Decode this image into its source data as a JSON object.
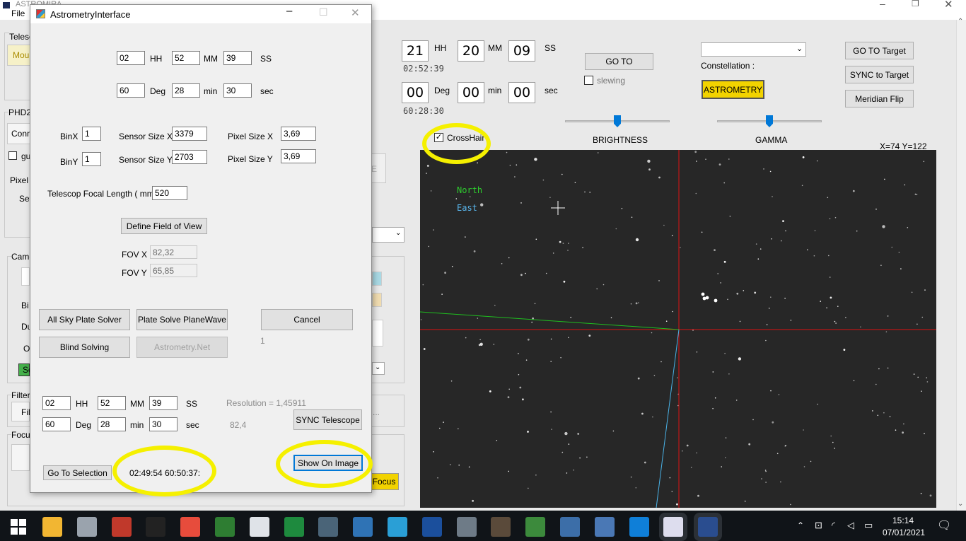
{
  "main": {
    "app_title": "ASTROMIRA",
    "menu_file": "File",
    "bg_fragments": [
      "Telesc",
      "Mour",
      "PHD2",
      "Conn",
      "gu",
      "Pixel",
      "Set",
      "Came",
      "Bi",
      "Du",
      "O",
      "Se",
      "Filter",
      "Fil",
      "Focu",
      "Focus",
      "E"
    ],
    "time": {
      "hh": "21",
      "mm": "20",
      "ss": "09",
      "hh_label": "HH",
      "mm_label": "MM",
      "ss_label": "SS",
      "readout": "02:52:39"
    },
    "dec": {
      "deg": "00",
      "min": "00",
      "sec": "00",
      "deg_label": "Deg",
      "min_label": "min",
      "sec_label": "sec",
      "readout": "60:28:30"
    },
    "goto_label": "GO TO",
    "slewing_label": "slewing",
    "crosshair_label": "CrossHair",
    "constellation_label": "Constellation :",
    "astrometry_label": "ASTROMETRY",
    "goto_target_label": "GO TO Target",
    "sync_target_label": "SYNC to Target",
    "meridian_flip_label": "Meridian Flip",
    "brightness_label": "BRIGHTNESS",
    "gamma_label": "GAMMA",
    "coords_label": "X=74 Y=122",
    "north_label": "North",
    "east_label": "East"
  },
  "dialog": {
    "title": "AstrometryInterface",
    "ra": {
      "hh": "02",
      "mm": "52",
      "ss": "39",
      "hh_label": "HH",
      "mm_label": "MM",
      "ss_label": "SS"
    },
    "dec": {
      "deg": "60",
      "min": "28",
      "sec": "30",
      "deg_label": "Deg",
      "min_label": "min",
      "sec_label": "sec"
    },
    "binx_label": "BinX",
    "binx": "1",
    "biny_label": "BinY",
    "biny": "1",
    "sensor_x_label": "Sensor Size X",
    "sensor_x": "3379",
    "sensor_y_label": "Sensor Size Y",
    "sensor_y": "2703",
    "pixel_x_label": "Pixel Size X",
    "pixel_x": "3,69",
    "pixel_y_label": "Pixel Size Y",
    "pixel_y": "3,69",
    "focal_label": "Telescop Focal Length ( mm )",
    "focal": "520",
    "define_fov_label": "Define Field of View",
    "fovx_label": "FOV X",
    "fovx": "82,32",
    "fovy_label": "FOV Y",
    "fovy": "65,85",
    "all_sky_label": "All Sky Plate Solver",
    "planewave_label": "Plate Solve PlaneWave",
    "cancel_label": "Cancel",
    "blind_label": "Blind Solving",
    "astrometry_net_label": "Astrometry.Net",
    "counter": "1",
    "result_ra": {
      "hh": "02",
      "mm": "52",
      "ss": "39",
      "hh_label": "HH",
      "mm_label": "MM",
      "ss_label": "SS"
    },
    "result_dec": {
      "deg": "60",
      "min": "28",
      "sec": "30",
      "deg_label": "Deg",
      "min_label": "min",
      "sec_label": "sec"
    },
    "resolution_label": "Resolution = 1,45911",
    "fov_value": "82,4",
    "sync_telescope_label": "SYNC Telescope",
    "go_to_selection_label": "Go To Selection",
    "selection_coords": "02:49:54 60:50:37:",
    "show_on_image_label": "Show On Image"
  },
  "taskbar": {
    "time": "15:14",
    "date": "07/01/2021",
    "icons": [
      "windows-start-icon",
      "file-explorer-icon",
      "app-icon-1",
      "sharpcap-icon",
      "starfield-icon",
      "spreadsheet-icon",
      "registax-icon",
      "telescope-icon",
      "app-round-icon",
      "calculator-icon",
      "settings-icon",
      "star-icon",
      "asi-icon",
      "gallery-icon",
      "app-icon-2",
      "chart-icon",
      "app-icon-3",
      "app-icon-4",
      "edge-icon",
      "mira-icon",
      "astromira-icon"
    ],
    "colors": {
      "bar": "#101418",
      "accent": "#f2d300",
      "highlight": "#f5f000"
    }
  }
}
